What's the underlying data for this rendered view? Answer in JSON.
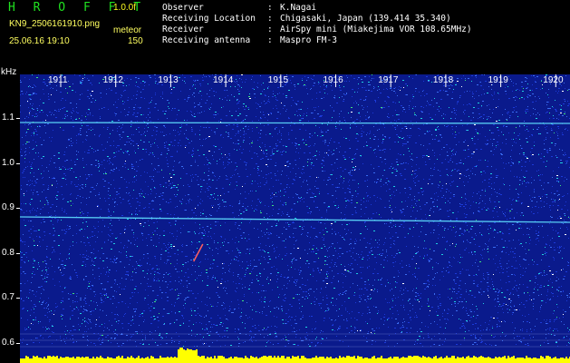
{
  "header": {
    "app_name": "H R O F F T",
    "version": "1.0.0f",
    "filename": "KN9_2506161910.png",
    "mode": "meteor",
    "datetime": "25.06.16 19:10",
    "value": "150",
    "colors": {
      "app_name": "#20e020",
      "version": "#ffff20",
      "info": "#ffff60"
    }
  },
  "observer_info": [
    {
      "label": "Observer",
      "value": "K.Nagai"
    },
    {
      "label": "Receiving Location",
      "value": "Chigasaki, Japan (139.414 35.340)"
    },
    {
      "label": "Receiver",
      "value": "AirSpy mini (Miakejima VOR 108.65MHz)"
    },
    {
      "label": "Receiving antenna",
      "value": "Maspro FM-3"
    }
  ],
  "spectrogram": {
    "y_unit": "kHz",
    "y_ticks": [
      "1.1",
      "1.0",
      "0.9",
      "0.8",
      "0.7",
      "0.6"
    ],
    "x_ticks": [
      "1911",
      "1912",
      "1913",
      "1914",
      "1915",
      "1916",
      "1917",
      "1918",
      "1919",
      "1920"
    ],
    "colors": {
      "background": "#0a1a8c",
      "noise": [
        "#1c3ad8",
        "#3a6cf0",
        "#20d0e0",
        "#ffffff",
        "#40e080"
      ],
      "carrier_line": "#60e0ff",
      "meteor": "#ff6060",
      "bottom_bar": "#ffff00"
    },
    "carriers_khz": [
      1.09,
      0.88
    ],
    "meteor_trail": {
      "time_start": "1913:25",
      "time_end": "1913:35",
      "khz_start": 0.78,
      "khz_end": 0.82
    }
  }
}
